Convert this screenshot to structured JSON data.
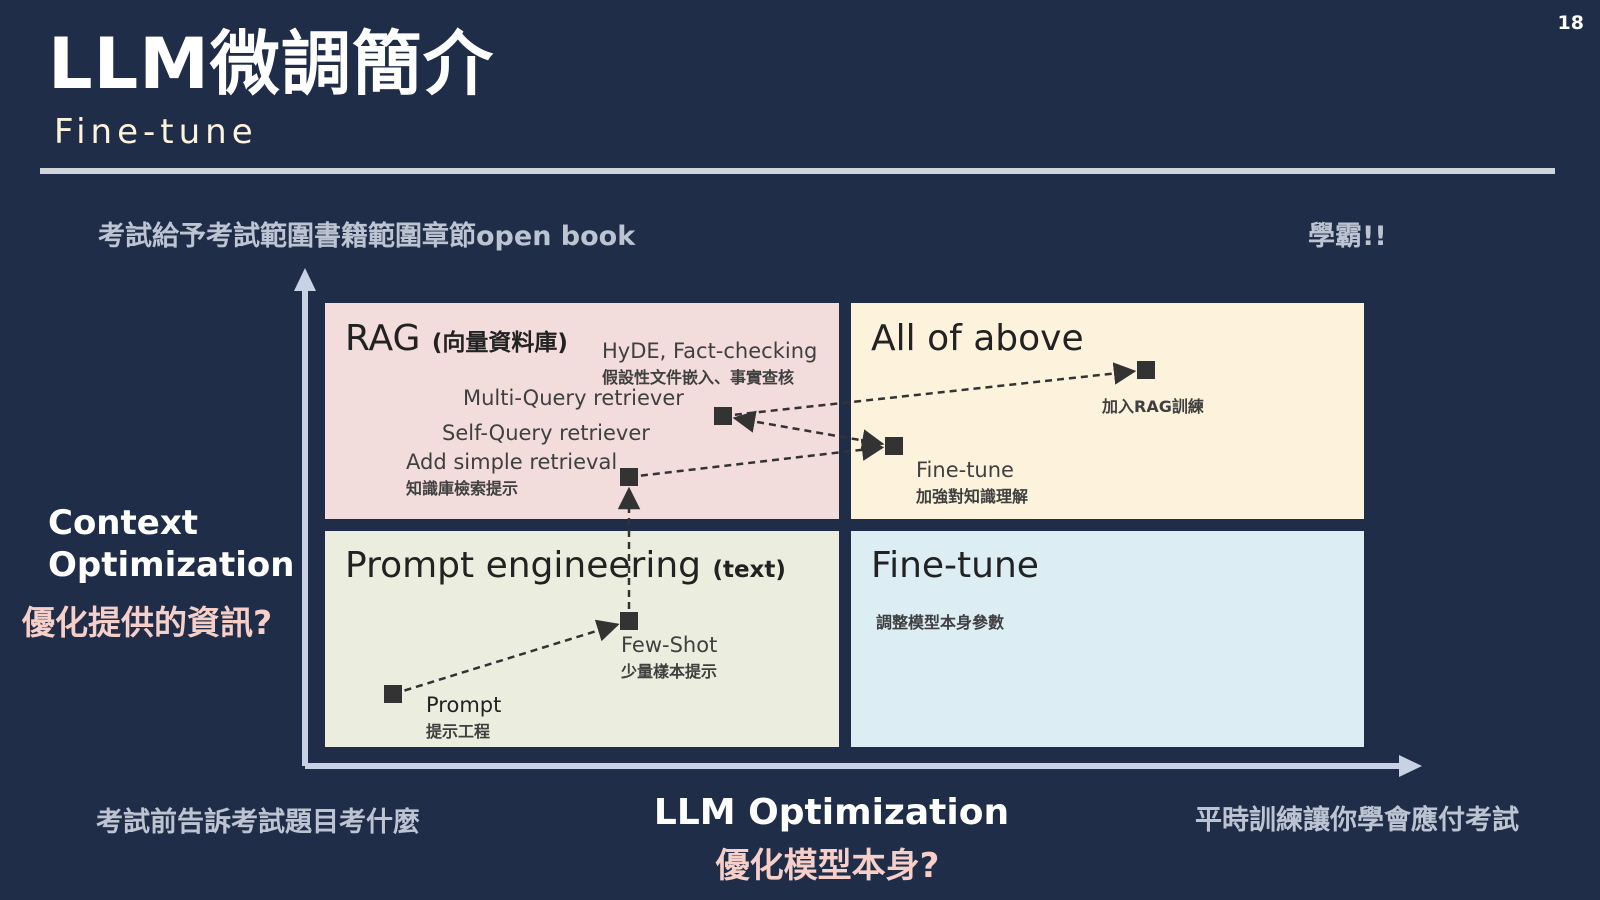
{
  "page_number": "18",
  "title": "LLM微調簡介",
  "subtitle": "Fine-tune",
  "captions": {
    "top_left": "考試給予考試範圍書籍範圍章節open book",
    "top_right": "學霸!!",
    "bottom_left": "考試前告訴考試題目考什麼",
    "bottom_right": "平時訓練讓你學會應付考試"
  },
  "axes": {
    "y_label": [
      "Context",
      "Optimization"
    ],
    "y_sublabel": "優化提供的資訊?",
    "x_label": "LLM Optimization",
    "x_sublabel": "優化模型本身?"
  },
  "quadrants": {
    "rag": {
      "title": "RAG",
      "subtitle": "(向量資料庫)",
      "color": "#f2dcdc"
    },
    "all": {
      "title": "All of above",
      "color": "#fdf3dc"
    },
    "prompt": {
      "title": "Prompt engineering",
      "subtitle": "(text)",
      "color": "#ebeedf"
    },
    "finetune": {
      "title": "Fine-tune",
      "note": "調整模型本身參數",
      "color": "#dcedf4"
    }
  },
  "labels": {
    "hyde": "HyDE, Fact-checking",
    "hyde_zh": "假設性文件嵌入、事實查核",
    "multi_query": "Multi-Query retriever",
    "self_query": "Self-Query retriever",
    "add_retrieval": "Add simple retrieval",
    "add_retrieval_zh": "知識庫檢索提示",
    "add_rag": "加入RAG訓練",
    "finetune": "Fine-tune",
    "finetune_zh": "加強對知識理解",
    "few_shot": "Few-Shot",
    "few_shot_zh": "少量樣本提示",
    "prompt": "Prompt",
    "prompt_zh": "提示工程"
  },
  "colors": {
    "background": "#1f2d48",
    "axis": "#c9d2e4",
    "marker": "#333333",
    "accent_text": "#f6cfc9"
  },
  "chart_data": {
    "type": "scatter",
    "xlabel": "LLM Optimization",
    "ylabel": "Context Optimization",
    "points": [
      {
        "key": "prompt"
      },
      {
        "key": "few_shot"
      },
      {
        "key": "add_retrieval"
      },
      {
        "key": "multi_query"
      },
      {
        "key": "finetune"
      },
      {
        "key": "add_rag"
      }
    ],
    "links": [
      [
        "prompt",
        "few_shot"
      ],
      [
        "few_shot",
        "add_retrieval"
      ],
      [
        "add_retrieval",
        "finetune"
      ],
      [
        "finetune",
        "multi_query"
      ],
      [
        "multi_query",
        "add_rag"
      ]
    ]
  }
}
